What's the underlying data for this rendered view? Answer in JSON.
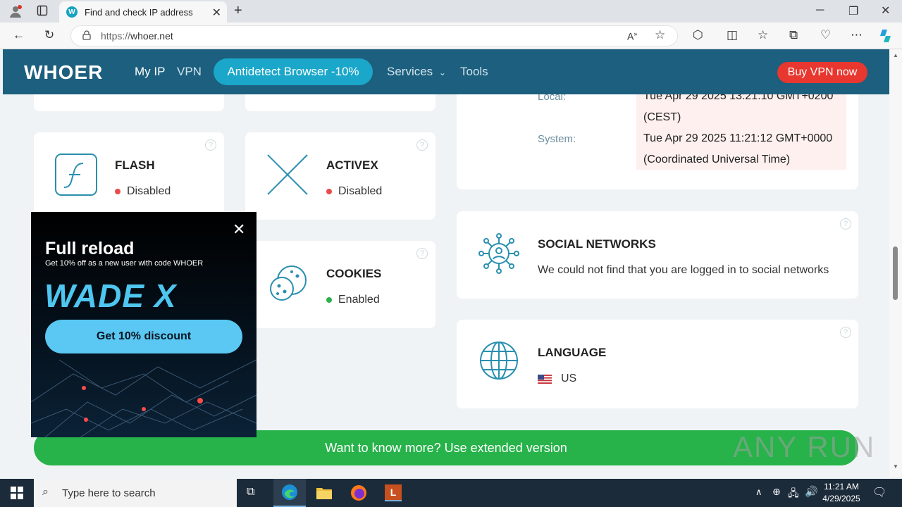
{
  "browser": {
    "tab_title": "Find and check IP address",
    "tab_favicon": "W",
    "url_prefix": "https://",
    "url_domain": "whoer.net"
  },
  "header": {
    "logo": "WHOER",
    "nav": [
      "My IP",
      "VPN"
    ],
    "antidetect": "Antidetect Browser -10%",
    "services": "Services",
    "tools": "Tools",
    "buy_vpn": "Buy VPN now"
  },
  "cards": {
    "flash": {
      "title": "FLASH",
      "status": "Disabled",
      "status_color": "#e84b4b"
    },
    "activex": {
      "title": "ACTIVEX",
      "status": "Disabled",
      "status_color": "#e84b4b"
    },
    "cookies": {
      "title": "COOKIES",
      "status": "Enabled",
      "status_color": "#2bb24c"
    },
    "time": {
      "local_label": "Local:",
      "local_value_1": "Tue Apr 29 2025 13:21:10 GMT+0200",
      "local_value_2": "(CEST)",
      "system_label": "System:",
      "system_value_1": "Tue Apr 29 2025 11:21:12 GMT+0000",
      "system_value_2": "(Coordinated Universal Time)"
    },
    "social": {
      "title": "SOCIAL NETWORKS",
      "text": "We could not find that you are logged in to social networks"
    },
    "language": {
      "title": "LANGUAGE",
      "value": "US"
    }
  },
  "more_button": "Want to know more? Use extended version",
  "watermark": "ANY RUN",
  "ad": {
    "title": "Full reload",
    "subtitle": "Get 10% off as a new user with code WHOER",
    "brand": "WADE X",
    "button": "Get 10% discount"
  },
  "taskbar": {
    "search_placeholder": "Type here to search",
    "time": "11:21 AM",
    "date": "4/29/2025"
  },
  "colors": {
    "header": "#1d5f7e",
    "accent": "#1aa7c9",
    "buy": "#e8372f",
    "green": "#27b24a"
  }
}
